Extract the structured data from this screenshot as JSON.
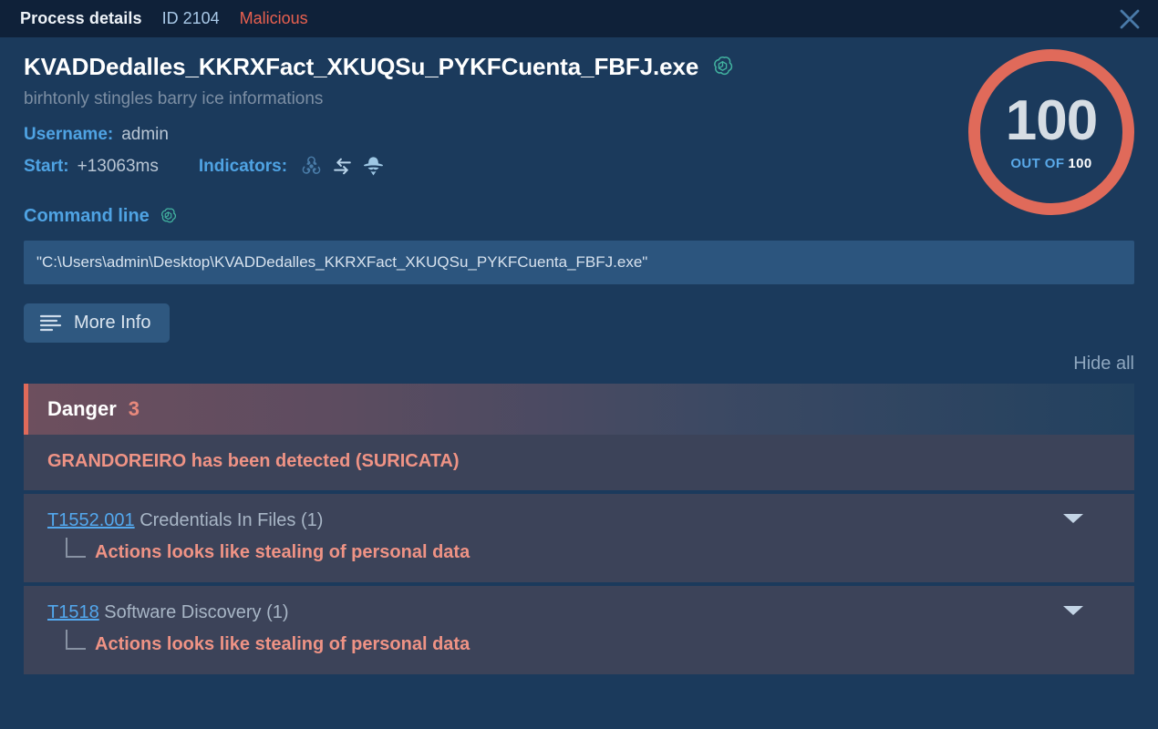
{
  "titlebar": {
    "title": "Process details",
    "process_id": "ID 2104",
    "verdict": "Malicious",
    "close_icon": "close-icon"
  },
  "process": {
    "file_name": "KVADDedalles_KKRXFact_XKUQSu_PYKFCuenta_FBFJ.exe",
    "subtitle": "birhtonly stingles barry ice informations",
    "username_label": "Username:",
    "username_value": "admin",
    "start_label": "Start:",
    "start_value": "+13063ms",
    "indicators_label": "Indicators:",
    "indicator_icons": [
      "biohazard-icon",
      "network-arrows-icon",
      "spy-hat-icon"
    ],
    "ai_icon": "openai-logo-icon"
  },
  "score": {
    "value": "100",
    "out_of_label": "OUT OF",
    "total": "100",
    "ring_color": "#e06a5a"
  },
  "command_line": {
    "label": "Command line",
    "ai_icon": "openai-logo-icon",
    "value": "\"C:\\Users\\admin\\Desktop\\KVADDedalles_KKRXFact_XKUQSu_PYKFCuenta_FBFJ.exe\""
  },
  "actions": {
    "more_info_label": "More Info",
    "more_info_icon": "list-lines-icon",
    "hide_all_label": "Hide all"
  },
  "danger": {
    "title": "Danger",
    "count": "3",
    "accent_color": "#e06a5a",
    "detection": "GRANDOREIRO has been detected (SURICATA)",
    "techniques": [
      {
        "id": "T1552.001",
        "name": "Credentials In Files (1)",
        "detail": "Actions looks like stealing of personal data",
        "expand_icon": "chevron-down-icon"
      },
      {
        "id": "T1518",
        "name": "Software Discovery (1)",
        "detail": "Actions looks like stealing of personal data",
        "expand_icon": "chevron-down-icon"
      }
    ]
  }
}
